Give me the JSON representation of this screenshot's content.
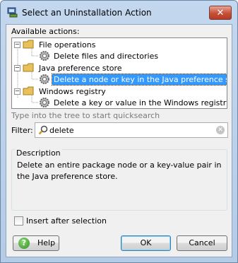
{
  "window": {
    "title": "Select an Uninstallation Action",
    "close_symbol": "✕"
  },
  "available_actions_label": "Available actions:",
  "tree": {
    "nodes": [
      {
        "label": "File operations",
        "expanded": true,
        "children": [
          {
            "label": "Delete files and directories"
          }
        ]
      },
      {
        "label": "Java preference store",
        "expanded": true,
        "children": [
          {
            "label": "Delete a node or key in the Java preference store",
            "selected": true
          }
        ]
      },
      {
        "label": "Windows registry",
        "expanded": true,
        "children": [
          {
            "label": "Delete a key or value in the Windows registry"
          }
        ]
      }
    ]
  },
  "quicksearch_hint": "Type into the tree to start quicksearch",
  "filter": {
    "label": "Filter:",
    "value": "delete"
  },
  "description": {
    "title": "Description",
    "text": "Delete an entire package node or a key-value pair in the Java preference store."
  },
  "insert_after_selection": {
    "label": "Insert after selection",
    "checked": false
  },
  "buttons": {
    "help": "Help",
    "ok": "OK",
    "cancel": "Cancel"
  },
  "colors": {
    "selection": "#3399ff",
    "folder": "#e8c15a",
    "help_icon": "#2f8f1f"
  }
}
